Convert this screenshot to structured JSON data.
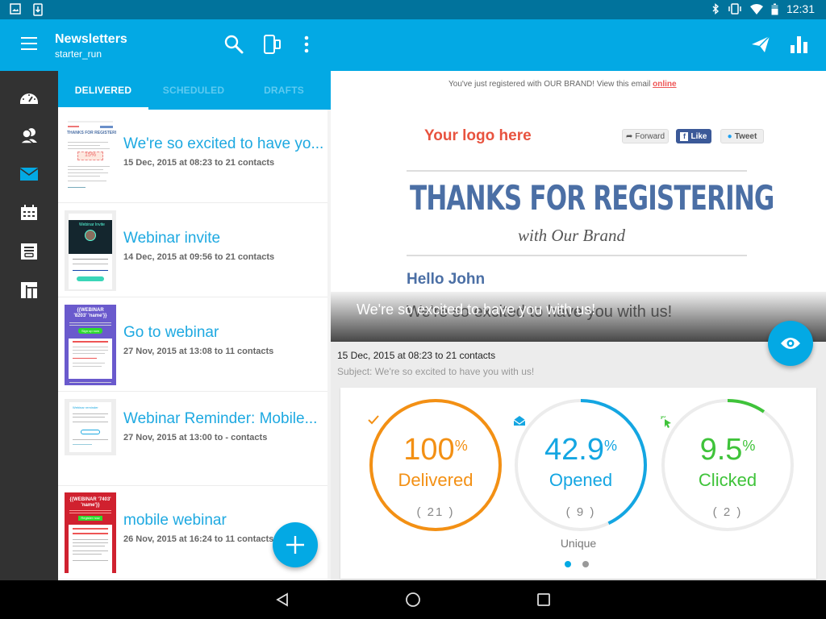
{
  "status_bar": {
    "time": "12:31"
  },
  "toolbar": {
    "title": "Newsletters",
    "subtitle": "starter_run"
  },
  "tabs": [
    {
      "label": "DELIVERED",
      "active": true
    },
    {
      "label": "SCHEDULED",
      "active": false
    },
    {
      "label": "DRAFTS",
      "active": false
    }
  ],
  "sidebar": {
    "items": [
      {
        "name": "dashboard",
        "active": false
      },
      {
        "name": "contacts",
        "active": false
      },
      {
        "name": "campaigns",
        "active": true
      },
      {
        "name": "calendar",
        "active": false
      },
      {
        "name": "forms",
        "active": false
      },
      {
        "name": "templates",
        "active": false
      }
    ]
  },
  "newsletters": [
    {
      "title": "We're so excited to have yo...",
      "meta": "15 Dec, 2015 at 08:23 to 21 contacts"
    },
    {
      "title": "Webinar invite",
      "meta": "14 Dec, 2015 at 09:56 to 21 contacts"
    },
    {
      "title": "Go to webinar",
      "meta": "27 Nov, 2015 at 13:08 to 11 contacts"
    },
    {
      "title": "Webinar Reminder: Mobile...",
      "meta": "27 Nov, 2015 at 13:00 to - contacts"
    },
    {
      "title": "mobile webinar",
      "meta": "26 Nov, 2015 at 16:24 to 11 contacts"
    }
  ],
  "thumbnails": {
    "t1_heading": "THANKS FOR REGISTERING",
    "t1_badge": "15%",
    "t2_heading": "Webinar Invite",
    "t3_heading": "{{WEBINAR '8203' 'name'}}",
    "t3_button": "Sign up now",
    "t4_heading": "Webinar reminder",
    "t5_heading": "{{WEBINAR '7403' 'name'}}",
    "t5_button": "Register now"
  },
  "email_preview": {
    "preheader": "You've just registered with OUR BRAND! View this email",
    "preheader_link": "online",
    "logo": "Your logo here",
    "forward": "Forward",
    "like": "Like",
    "tweet": "Tweet",
    "headline": "THANKS FOR REGISTERING",
    "subheadline": "with Our Brand",
    "greeting": "Hello John",
    "body_line": "We're so excited to have you with us!"
  },
  "detail": {
    "overlay_title": "We're so excited to have you with us!",
    "date_line": "15 Dec, 2015 at 08:23 to 21 contacts",
    "subject_line": "Subject: We're so excited to have you with us!"
  },
  "stats": {
    "unique_label": "Unique",
    "pager": {
      "pages": 2,
      "current": 0
    },
    "gauges": [
      {
        "label": "Delivered",
        "value": "100",
        "percent": 100,
        "count": "( 21 )",
        "icon": "checkmark-icon",
        "color": "#f39014"
      },
      {
        "label": "Opened",
        "value": "42.9",
        "percent": 42.9,
        "count": "( 9 )",
        "icon": "open-envelope-icon",
        "color": "#14a6e2"
      },
      {
        "label": "Clicked",
        "value": "9.5",
        "percent": 9.5,
        "count": "( 2 )",
        "icon": "cursor-click-icon",
        "color": "#3fc33a"
      }
    ],
    "percent_sign": "%"
  },
  "colors": {
    "primary": "#03a9e4",
    "status_bar": "#01739c",
    "sidebar": "#323232",
    "link": "#1ea9e1"
  }
}
